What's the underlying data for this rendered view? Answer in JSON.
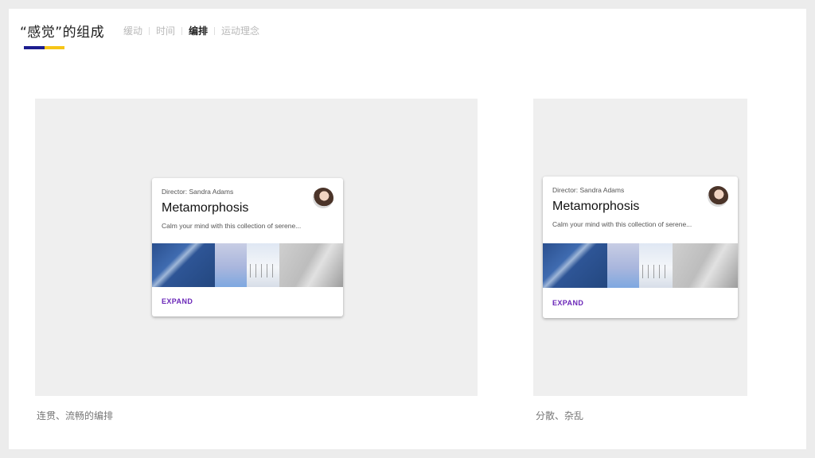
{
  "header": {
    "title": "“感觉”的组成",
    "accent_colors": {
      "blue": "#1c1d8f",
      "yellow": "#f6c517"
    }
  },
  "nav": {
    "items": [
      {
        "label": "缓动",
        "active": false
      },
      {
        "label": "时间",
        "active": false
      },
      {
        "label": "编排",
        "active": true
      },
      {
        "label": "运动理念",
        "active": false
      }
    ]
  },
  "examples": [
    {
      "caption": "连贯、流畅的编排",
      "card": {
        "director": "Director: Sandra Adams",
        "title": "Metamorphosis",
        "description": "Calm your mind with this collection of serene...",
        "action": "EXPAND",
        "avatar_icon": "avatar-photo"
      }
    },
    {
      "caption": "分散、杂乱",
      "card": {
        "director": "Director: Sandra Adams",
        "title": "Metamorphosis",
        "description": "Calm your mind with this collection of serene...",
        "action": "EXPAND",
        "avatar_icon": "avatar-photo"
      }
    }
  ],
  "colors": {
    "action": "#6a26b8",
    "stage": "#efefef"
  }
}
